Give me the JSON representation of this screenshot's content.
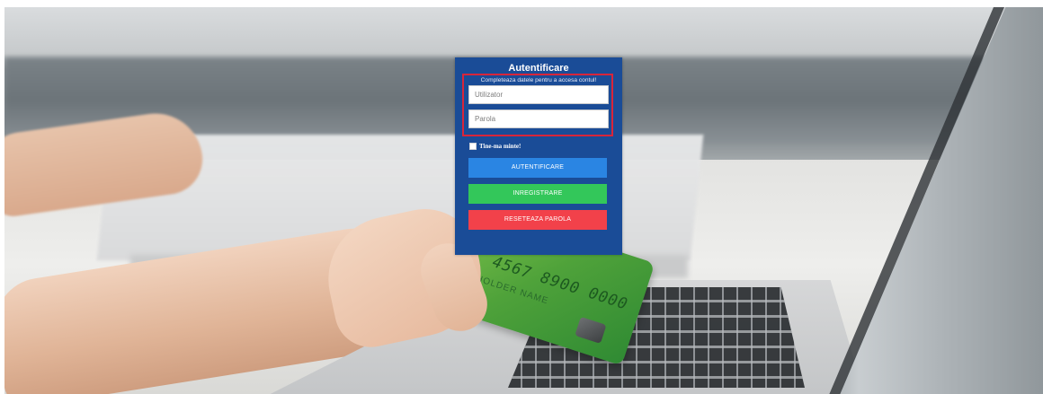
{
  "login": {
    "title": "Autentificare",
    "subtitle": "Completeaza datele pentru a accesa contul!",
    "username_placeholder": "Utilizator",
    "password_placeholder": "Parola",
    "remember_label": "Tine-ma minte!",
    "login_button": "AUTENTIFICARE",
    "register_button": "INREGISTRARE",
    "reset_button": "RESETEAZA PAROLA"
  },
  "card": {
    "number_text": "4567 8900 0000",
    "holder_text": "HOLDER NAME"
  },
  "colors": {
    "panel": "#1a4c97",
    "login_button": "#2a85e3",
    "register_button": "#33c75a",
    "reset_button": "#f2414a",
    "highlight_border": "#d8253a"
  }
}
